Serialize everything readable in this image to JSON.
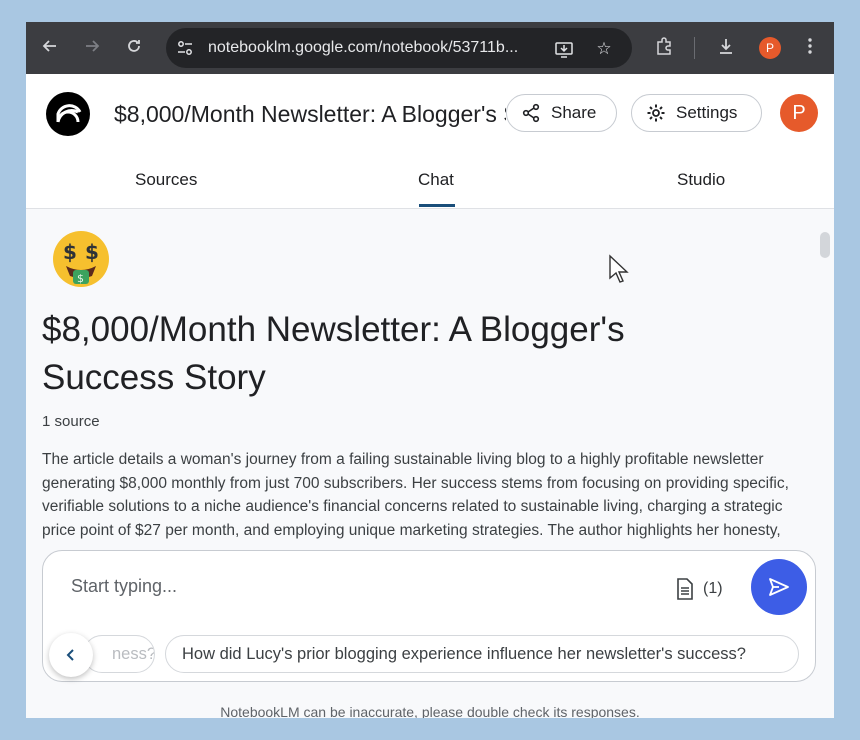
{
  "browser": {
    "url": "notebooklm.google.com/notebook/53711b...",
    "profile_initial": "P",
    "icons": [
      "back-arrow-icon",
      "forward-arrow-icon",
      "reload-icon",
      "site-info-icon",
      "install-app-icon",
      "bookmark-star-icon",
      "extensions-icon",
      "download-icon",
      "menu-dots-icon"
    ]
  },
  "app": {
    "notebook_title": "$8,000/Month Newsletter: A Blogger's Success Story",
    "share_label": "Share",
    "settings_label": "Settings",
    "avatar_initial": "P"
  },
  "tabs": [
    {
      "label": "Sources"
    },
    {
      "label": "Chat",
      "active": true
    },
    {
      "label": "Studio"
    }
  ],
  "content": {
    "emoji": "money-mouth-face-icon",
    "title": "$8,000/Month Newsletter: A Blogger's Success Story",
    "source_count": "1 source",
    "summary": "The article details a woman's journey from a failing sustainable living blog to a highly profitable newsletter generating $8,000 monthly from just 700 subscribers. Her success stems from focusing on providing specific, verifiable solutions to a niche audience's financial concerns related to sustainable living, charging a strategic price point of $27 per month, and employing unique marketing strategies. The author highlights her honesty, meticulous product testing, and detailed reporting of cost savings as key factors. The piece"
  },
  "composer": {
    "placeholder": "Start typing...",
    "source_badge": "(1)",
    "chips": [
      {
        "label": "ness?"
      },
      {
        "label": "How did Lucy's prior blogging experience influence her newsletter's success?"
      }
    ]
  },
  "footer_note": "NotebookLM can be inaccurate, please double check its responses.",
  "colors": {
    "accent": "#3d5de6",
    "avatar": "#e65a2b",
    "tab_indicator": "#1a4e7a"
  }
}
